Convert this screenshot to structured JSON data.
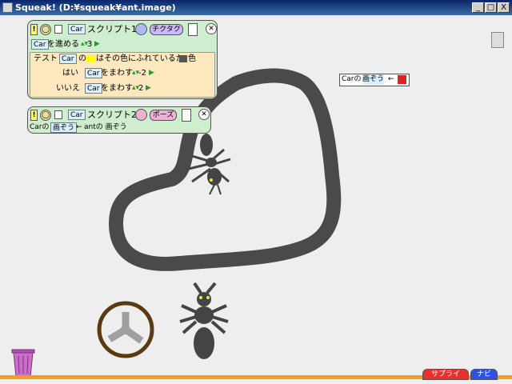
{
  "window": {
    "title": "Squeak!  (D:¥squeak¥ant.image)",
    "min": "_",
    "max": "□",
    "close": "X"
  },
  "script1": {
    "exclaim": "!",
    "circle": "◯",
    "square": "",
    "car_tile": "Car",
    "title": "スクリプト1",
    "tick_label": "チクタク",
    "forward_tile": "Car",
    "forward_label": "を進める",
    "forward_value": "3",
    "test_label": "テスト",
    "test_car": "Car",
    "test_of": "の",
    "test_text": "はその色にふれているか",
    "test_color_label": "色",
    "yes_label": "はい",
    "yes_car": "Car",
    "yes_turn": "をまわす",
    "yes_value": "-2",
    "no_label": "いいえ",
    "no_car": "Car",
    "no_turn": "をまわす",
    "no_value": "2"
  },
  "script2": {
    "exclaim": "!",
    "circle": "◯",
    "square": "",
    "car_tile": "Car",
    "title": "スクリプト2",
    "pause_label": "ポーズ",
    "car_of": "Carの",
    "image_tile": "画ぞう",
    "assign": "←",
    "ant_text": "antの 画ぞう"
  },
  "status_tile": {
    "car_of": "Carの",
    "image": "画ぞう",
    "assign": "←"
  },
  "colors": {
    "track": "#4a4a4a",
    "wheel": "#5a3a10",
    "tile_bg": "#d8f0ff",
    "script_bg": "#cfeecf",
    "pink": "#f0b0d8",
    "red_arrow": "#cc1111"
  },
  "bottom": {
    "btn1": "サプライ",
    "btn2": "ナビ"
  }
}
